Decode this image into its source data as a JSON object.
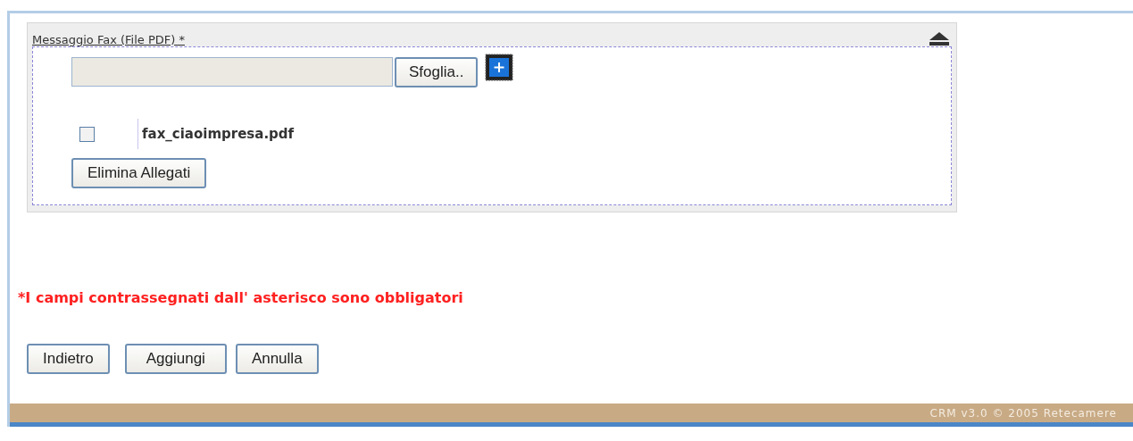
{
  "panel": {
    "title": "Messaggio Fax (File PDF) *",
    "expanded": true,
    "browse_button": "Sfoglia..",
    "attachments": [
      {
        "name": "fax_ciaoimpresa.pdf",
        "checked": false
      }
    ],
    "delete_button": "Elimina Allegati"
  },
  "required_note": "*I campi contrassegnati dall' asterisco sono obbligatori",
  "buttons": [
    "Indietro",
    "Aggiungi",
    "Annulla"
  ],
  "footer": "CRM v3.0 © 2005 Retecamere"
}
